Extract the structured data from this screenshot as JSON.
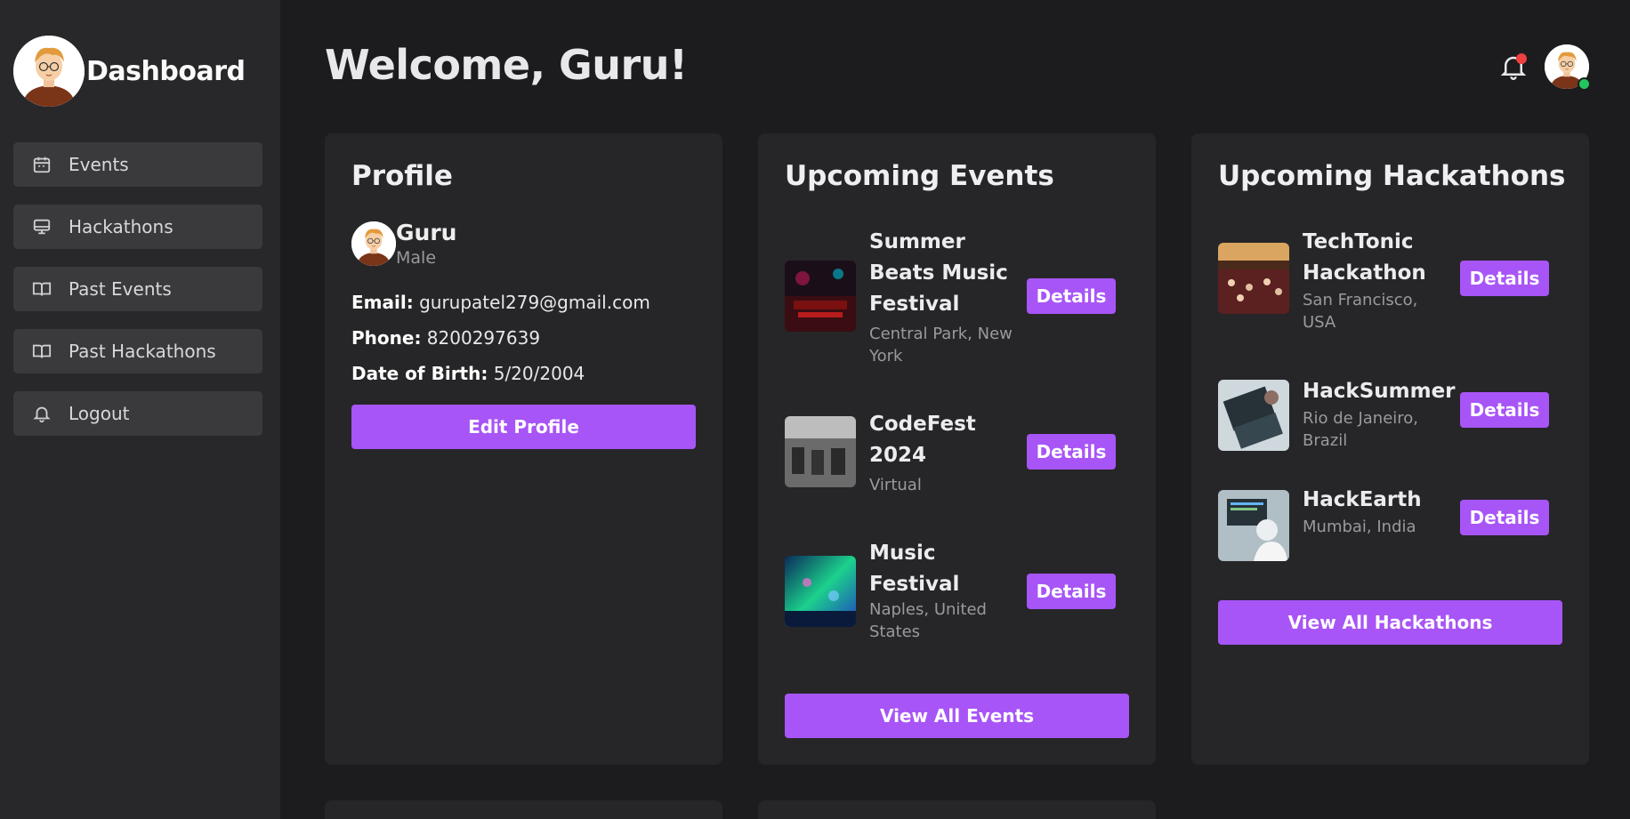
{
  "sidebar": {
    "title": "Dashboard",
    "items": [
      {
        "label": "Events",
        "icon": "calendar-icon"
      },
      {
        "label": "Hackathons",
        "icon": "monitor-icon"
      },
      {
        "label": "Past Events",
        "icon": "book-open-icon"
      },
      {
        "label": "Past Hackathons",
        "icon": "book-open-icon"
      },
      {
        "label": "Logout",
        "icon": "bell-icon"
      }
    ]
  },
  "header": {
    "welcome": "Welcome, Guru!",
    "has_notification": true,
    "user_online": true
  },
  "profile": {
    "heading": "Profile",
    "name": "Guru",
    "gender": "Male",
    "email_label": "Email:",
    "email": "gurupatel279@gmail.com",
    "phone_label": "Phone:",
    "phone": "8200297639",
    "dob_label": "Date of Birth:",
    "dob": "5/20/2004",
    "edit_label": "Edit Profile"
  },
  "events": {
    "heading": "Upcoming Events",
    "items": [
      {
        "title_lines": [
          "Summer",
          "Beats Music",
          "Festival"
        ],
        "location_lines": [
          "Central Park, New",
          "York"
        ],
        "button": "Details"
      },
      {
        "title_lines": [
          "CodeFest",
          "2024"
        ],
        "location_lines": [
          "Virtual"
        ],
        "button": "Details"
      },
      {
        "title_lines": [
          "Music",
          "Festival"
        ],
        "location_lines": [
          "Naples, United",
          "States"
        ],
        "button": "Details"
      }
    ],
    "view_all": "View All Events"
  },
  "hackathons": {
    "heading": "Upcoming Hackathons",
    "items": [
      {
        "title_lines": [
          "TechTonic",
          "Hackathon"
        ],
        "location_lines": [
          "San Francisco,",
          "USA"
        ],
        "button": "Details"
      },
      {
        "title_lines": [
          "HackSummer"
        ],
        "location_lines": [
          "Rio de Janeiro,",
          "Brazil"
        ],
        "button": "Details"
      },
      {
        "title_lines": [
          "HackEarth"
        ],
        "location_lines": [
          "Mumbai, India"
        ],
        "button": "Details"
      }
    ],
    "view_all": "View All Hackathons"
  },
  "colors": {
    "accent": "#a855f7",
    "background": "#1c1c1e",
    "sidebar": "#28282a",
    "card": "#262628",
    "notification_dot": "#ef3f3f",
    "online": "#22c55e"
  }
}
